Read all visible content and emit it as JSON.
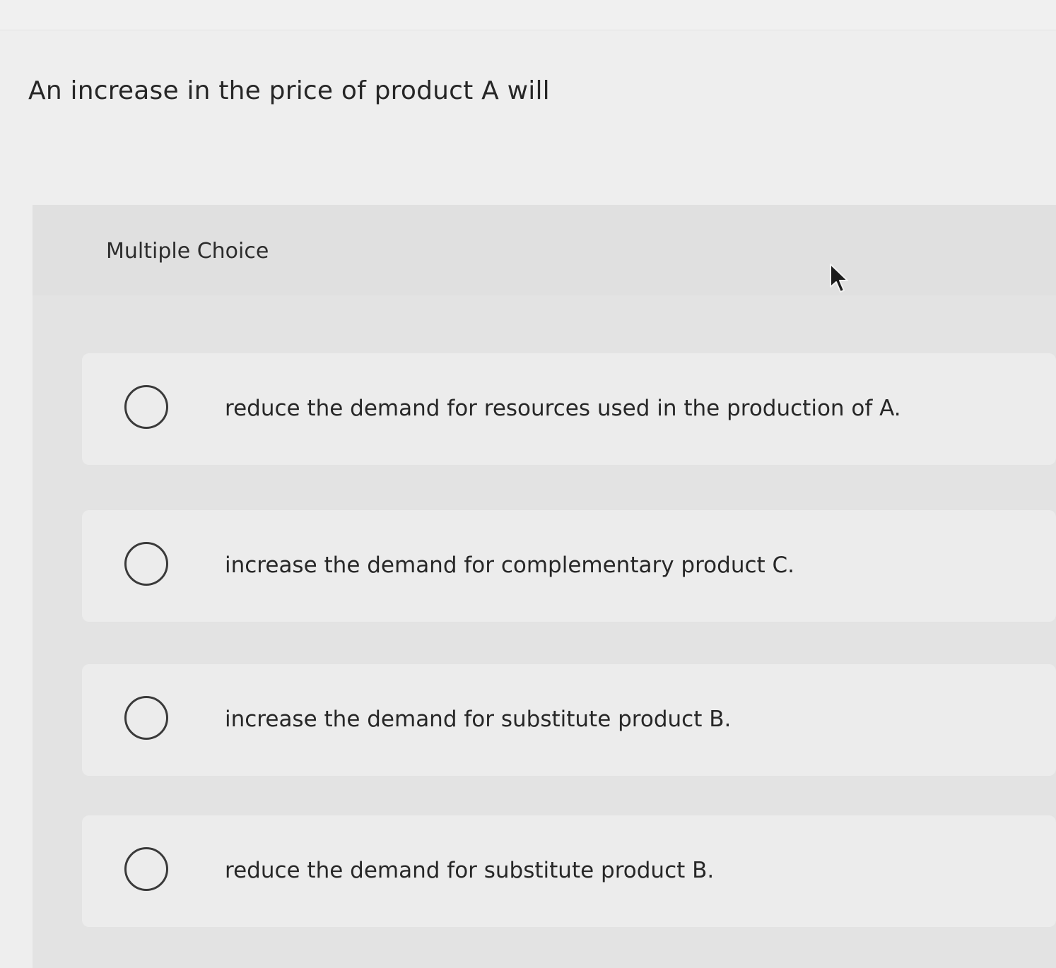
{
  "question": {
    "text": "An increase in the price of product A will"
  },
  "answer_panel": {
    "type_label": "Multiple Choice",
    "options": [
      {
        "text": "reduce the demand for resources used in the production of A.",
        "selected": false
      },
      {
        "text": "increase the demand for complementary product C.",
        "selected": false
      },
      {
        "text": "increase the demand for substitute product B.",
        "selected": false
      },
      {
        "text": "reduce the demand for substitute product B.",
        "selected": false
      }
    ]
  },
  "icons": {
    "cursor": "mouse-pointer-icon",
    "radio": "radio-unselected-icon"
  },
  "colors": {
    "background": "#eeeeee",
    "panel": "#e3e3e3",
    "option_card": "#ececec",
    "text": "#2b2b2b"
  }
}
